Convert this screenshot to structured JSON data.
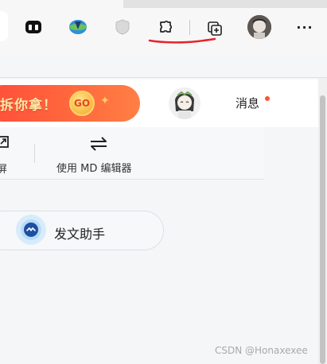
{
  "browser_toolbar": {
    "icons": [
      {
        "name": "extension-app-icon"
      },
      {
        "name": "download-manager-icon"
      },
      {
        "name": "shield-extension-icon"
      },
      {
        "name": "extensions-puzzle-icon"
      },
      {
        "name": "collections-icon"
      },
      {
        "name": "profile-avatar"
      },
      {
        "name": "more-menu-icon",
        "glyph": "···"
      }
    ]
  },
  "header": {
    "promo_text": "拆你拿！",
    "promo_badge": "GO",
    "messages_label": "消息"
  },
  "editor_bar": {
    "left_tool_label": "屏",
    "md_editor_label": "使用 MD 编辑器"
  },
  "assistant": {
    "label": "发文助手"
  },
  "watermark": "CSDN @Honaxexee",
  "colors": {
    "accent": "#fc5531",
    "promo_gradient_start": "#ff4d3a",
    "annotation_red": "#e8232b"
  }
}
